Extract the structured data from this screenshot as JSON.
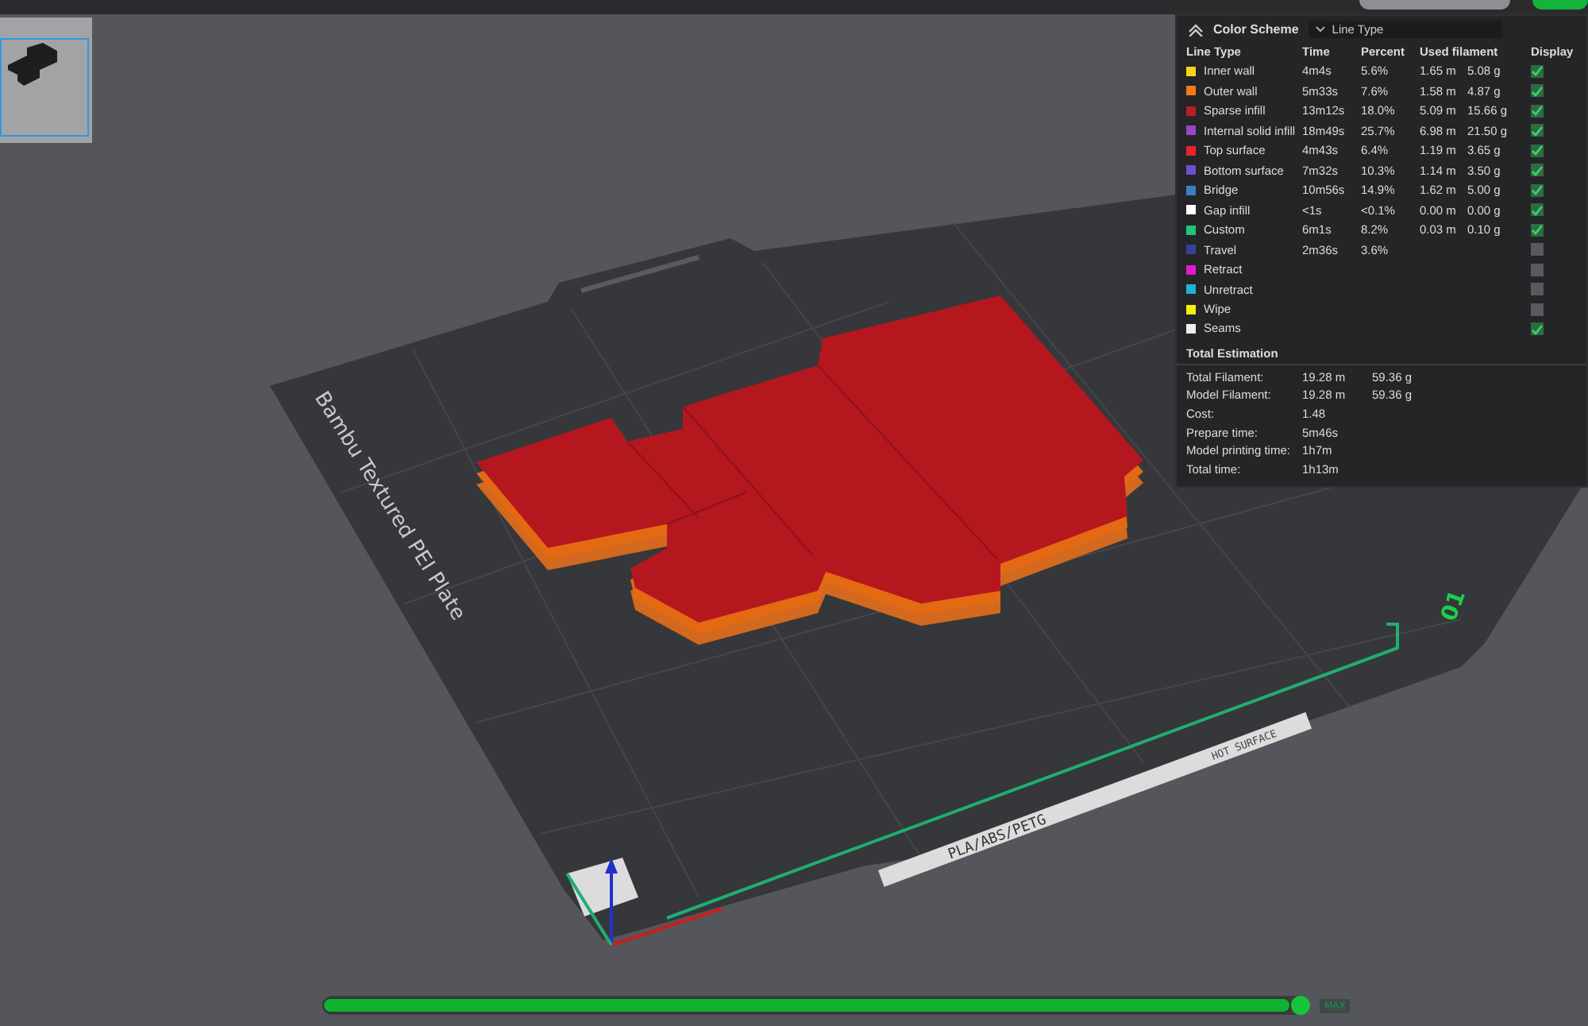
{
  "legend": {
    "title": "Color Scheme",
    "scheme": "Line Type",
    "columns": [
      "Line Type",
      "Time",
      "Percent",
      "Used filament",
      "Display"
    ],
    "rows": [
      {
        "name": "Inner wall",
        "color": "#f5d60f",
        "time": "4m4s",
        "percent": "5.6%",
        "length": "1.65 m",
        "weight": "5.08 g",
        "display": true
      },
      {
        "name": "Outer wall",
        "color": "#f07b1a",
        "time": "5m33s",
        "percent": "7.6%",
        "length": "1.58 m",
        "weight": "4.87 g",
        "display": true
      },
      {
        "name": "Sparse infill",
        "color": "#b81e23",
        "time": "13m12s",
        "percent": "18.0%",
        "length": "5.09 m",
        "weight": "15.66 g",
        "display": true
      },
      {
        "name": "Internal solid infill",
        "color": "#9a45c8",
        "time": "18m49s",
        "percent": "25.7%",
        "length": "6.98 m",
        "weight": "21.50 g",
        "display": true
      },
      {
        "name": "Top surface",
        "color": "#e8262a",
        "time": "4m43s",
        "percent": "6.4%",
        "length": "1.19 m",
        "weight": "3.65 g",
        "display": true
      },
      {
        "name": "Bottom surface",
        "color": "#6b4fcf",
        "time": "7m32s",
        "percent": "10.3%",
        "length": "1.14 m",
        "weight": "3.50 g",
        "display": true
      },
      {
        "name": "Bridge",
        "color": "#3b7fc0",
        "time": "10m56s",
        "percent": "14.9%",
        "length": "1.62 m",
        "weight": "5.00 g",
        "display": true
      },
      {
        "name": "Gap infill",
        "color": "#ffffff",
        "time": "<1s",
        "percent": "<0.1%",
        "length": "0.00 m",
        "weight": "0.00 g",
        "display": true
      },
      {
        "name": "Custom",
        "color": "#1ec47a",
        "time": "6m1s",
        "percent": "8.2%",
        "length": "0.03 m",
        "weight": "0.10 g",
        "display": true
      },
      {
        "name": "Travel",
        "color": "#3a3f9e",
        "time": "2m36s",
        "percent": "3.6%",
        "display": false
      },
      {
        "name": "Retract",
        "color": "#e01ad0",
        "display": false
      },
      {
        "name": "Unretract",
        "color": "#1fb3d6",
        "display": false
      },
      {
        "name": "Wipe",
        "color": "#f5f00a",
        "display": false
      },
      {
        "name": "Seams",
        "color": "#eeeeee",
        "display": true
      }
    ],
    "total_title": "Total Estimation",
    "totals": [
      {
        "label": "Total Filament:",
        "value": "19.28 m",
        "value_2": "59.36 g"
      },
      {
        "label": "Model Filament:",
        "value": "19.28 m",
        "value_2": "59.36 g"
      },
      {
        "label": "Cost:",
        "value": "1.48"
      },
      {
        "label": "Prepare time:",
        "value": "5m46s"
      },
      {
        "label": "Model printing time:",
        "value": "1h7m"
      },
      {
        "label": "Total time:",
        "value": "1h13m"
      }
    ]
  },
  "plate": {
    "name": "Bambu Textured PEI Plate",
    "materials": "PLA/ABS/PETG",
    "warning": "HOT SURFACE",
    "number": "01"
  },
  "layer_slider": {
    "level": 1.0,
    "label": "MAX"
  }
}
